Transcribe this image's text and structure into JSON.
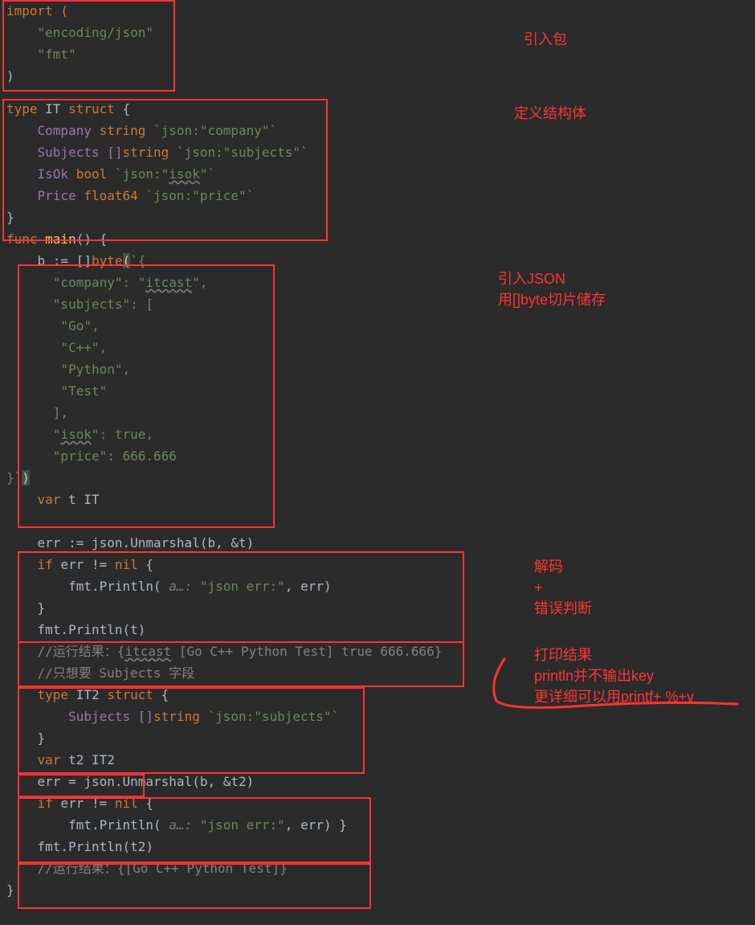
{
  "code": {
    "l1": "import (",
    "l2_indent": "    ",
    "l2_str": "\"encoding/json\"",
    "l3_str": "\"fmt\"",
    "l4": ")",
    "l5_type": "type",
    "l5_name": " IT ",
    "l5_struct": "struct",
    "l5_brace": " {",
    "l6_field": "    Company ",
    "l6_type": "string",
    "l6_tag": " `json:\"company\"`",
    "l7_field": "    Subjects []",
    "l7_type": "string",
    "l7_tag": " `json:\"subjects\"`",
    "l8_field": "    IsOk ",
    "l8_type": "bool",
    "l8_tag1": " `json:\"",
    "l8_tag_u": "isok",
    "l8_tag2": "\"`",
    "l9_field": "    Price ",
    "l9_type": "float64",
    "l9_tag": " `json:\"price\"`",
    "l10": "}",
    "l11_func": "func",
    "l11_main": " main",
    "l11_rest": "() {",
    "l12_a": "    b := []",
    "l12_byte": "byte",
    "l12_paren": "(",
    "l12_tick": "`{",
    "l13": "      \"company\": \"",
    "l13_u": "itcast",
    "l13_end": "\",",
    "l14": "      \"subjects\": [",
    "l15": "       \"Go\",",
    "l16": "       \"C++\",",
    "l17": "       \"Python\",",
    "l18": "       \"Test\"",
    "l19": "      ],",
    "l20": "      \"",
    "l20_u": "isok",
    "l20_end": "\": true,",
    "l21": "      \"price\": 666.666",
    "l22_brace": "}`",
    "l22_paren": ")",
    "l23_var": "    var",
    "l23_t": " t ",
    "l23_type": "IT",
    "l25_a": "    err := json.Unmarshal(b, &t)",
    "l26_if": "    if",
    "l26_rest": " err != ",
    "l26_nil": "nil",
    "l26_brace": " {",
    "l27_a": "        fmt.Println( ",
    "l27_hint": "a…:",
    "l27_str": " \"json err:\"",
    "l27_rest": ", err)",
    "l28": "    }",
    "l29": "    fmt.Println(t)",
    "l30_c": "    //运行结果：{",
    "l30_u": "itcast",
    "l30_rest": " [Go C++ Python Test] true 666.666}",
    "l31_c": "    //只想要 Subjects 字段",
    "l32_type": "    type",
    "l32_name": " IT2 ",
    "l32_struct": "struct",
    "l32_brace": " {",
    "l33_field": "        Subjects []",
    "l33_type": "string",
    "l33_tag": " `json:\"subjects\"`",
    "l34": "    }",
    "l35_var": "    var",
    "l35_t2": " t2 ",
    "l35_type": "IT2",
    "l36": "    err = json.Unmarshal(b, &t2)",
    "l37_if": "    if",
    "l37_rest": " err != ",
    "l37_nil": "nil",
    "l37_brace": " {",
    "l38_a": "        fmt.Println( ",
    "l38_hint": "a…:",
    "l38_str": " \"json err:\"",
    "l38_rest": ", err) }",
    "l39": "    fmt.Println(t2)",
    "l40_c": "    //运行结果：{[Go C++ Python Test]}",
    "l41": "}"
  },
  "annotations": {
    "a1": "引入包",
    "a2": "定义结构体",
    "a3": "引入JSON\n用[]byte切片储存",
    "a4": "解码\n+\n错误判断",
    "a5": "打印结果\nprintln并不输出key\n更详细可以用printf+ %+v"
  }
}
